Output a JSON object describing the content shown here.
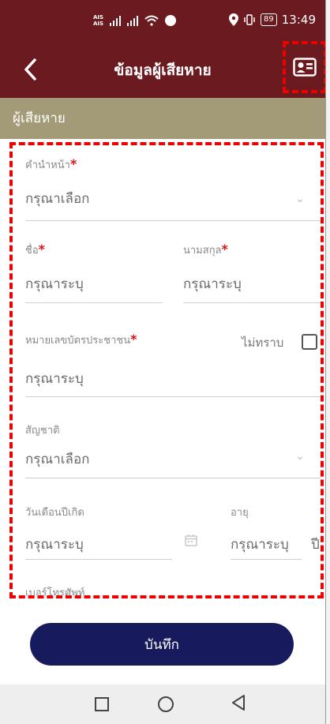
{
  "statusbar": {
    "carrier_top": "AIS",
    "carrier_bottom": "AIS",
    "battery": "89",
    "time": "13:49"
  },
  "appbar": {
    "title": "ข้อมูลผู้เสียหาย",
    "back_icon": "chevron-left-icon",
    "idcard_icon": "id-card-icon"
  },
  "section": {
    "title": "ผู้เสียหาย"
  },
  "form": {
    "prefix": {
      "label": "คำนำหน้า",
      "required": "*",
      "placeholder": "กรุณาเลือก"
    },
    "first_name": {
      "label": "ชื่อ",
      "required": "*",
      "placeholder": "กรุณาระบุ"
    },
    "last_name": {
      "label": "นามสกุล",
      "required": "*",
      "placeholder": "กรุณาระบุ"
    },
    "id_number": {
      "label": "หมายเลขบัตรประชาชน",
      "required": "*",
      "unknown_label": "ไม่ทราบ",
      "placeholder": "กรุณาระบุ"
    },
    "nationality": {
      "label": "สัญชาติ",
      "placeholder": "กรุณาเลือก"
    },
    "birthdate": {
      "label": "วันเดือนปีเกิด",
      "placeholder": "กรุณาระบุ"
    },
    "age": {
      "label": "อายุ",
      "placeholder": "กรุณาระบุ",
      "unit": "ปี"
    },
    "phone": {
      "label": "เบอร์โทรศัพท์"
    }
  },
  "actions": {
    "save_label": "บันทึก"
  },
  "colors": {
    "header": "#6b1a20",
    "section": "#a39b78",
    "save_button": "#171b5e",
    "highlight": "#e00000",
    "required": "#d11111"
  }
}
